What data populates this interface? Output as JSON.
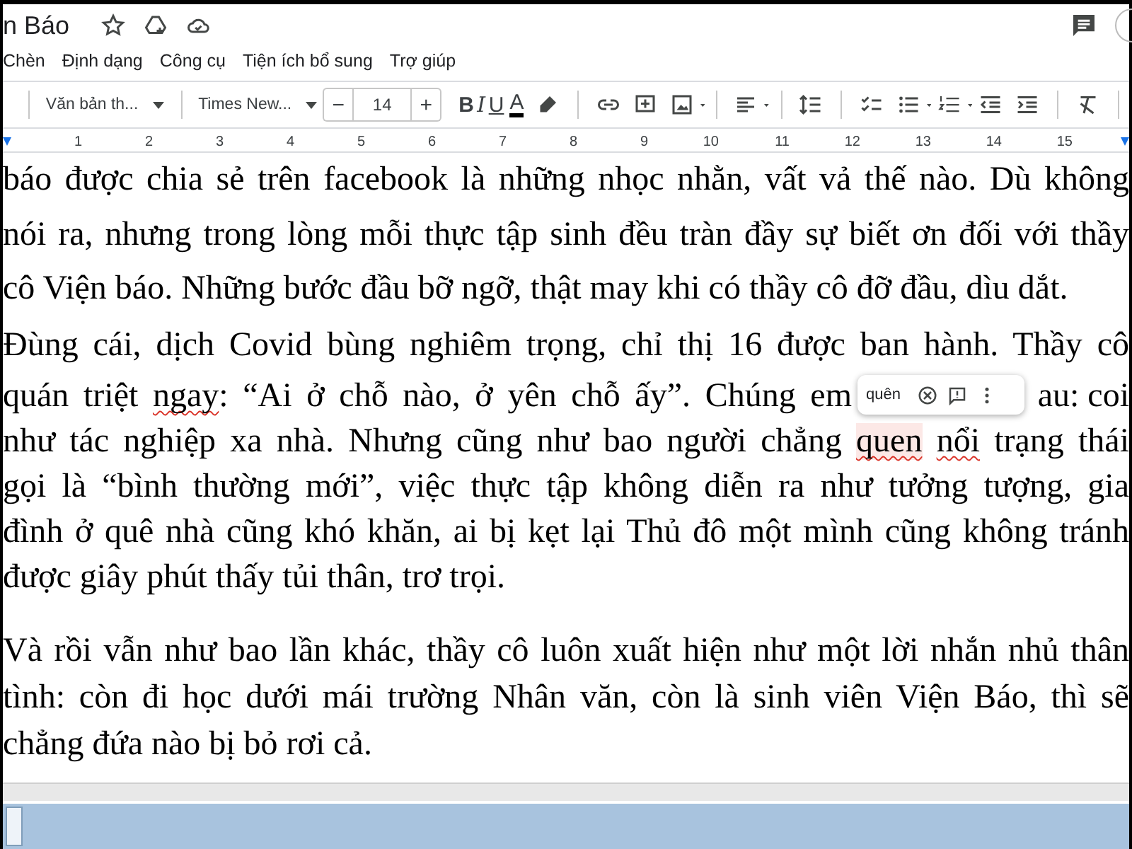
{
  "document": {
    "title": "n Báo"
  },
  "menu": [
    "Chèn",
    "Định dạng",
    "Công cụ",
    "Tiện ích bổ sung",
    "Trợ giúp"
  ],
  "toolbar": {
    "style": "Văn bản th...",
    "font": "Times New...",
    "decrease": "−",
    "size": "14",
    "increase": "+",
    "bold": "B",
    "italic": "I",
    "underline": "U",
    "text_color": "A"
  },
  "ruler": [
    "1",
    "2",
    "3",
    "4",
    "5",
    "6",
    "7",
    "8",
    "9",
    "10",
    "11",
    "12",
    "13",
    "14",
    "15"
  ],
  "paragraphs": [
    {
      "lines": [
        {
          "segments": [
            {
              "text": "báo được chia sẻ trên facebook là những nhọc nhằn, vất vả thế nào. Dù không",
              "flagged": false,
              "active": false
            }
          ]
        },
        {
          "segments": [
            {
              "text": "nói ra, nhưng trong lòng mỗi thực tập sinh đều tràn đầy sự biết ơn đối với thầy",
              "flagged": false,
              "active": false
            }
          ]
        },
        {
          "segments": [
            {
              "text": "cô Viện báo. Những bước đầu bỡ ngỡ, thật may khi có thầy cô đỡ đầu, dìu dắt.",
              "flagged": false,
              "active": false
            }
          ]
        }
      ]
    },
    {
      "lines": [
        {
          "segments": [
            {
              "text": "Đùng cái, dịch Covid bùng nghiêm trọng, chỉ thị 16 được ban hành. Thầy cô",
              "flagged": false,
              "active": false
            }
          ]
        },
        {
          "segments": [
            {
              "text": "quán triệt ",
              "flagged": false,
              "active": false
            },
            {
              "text": "ngay",
              "flagged": true,
              "active": false
            },
            {
              "text": ": “Ai ở chỗ nào, ở yên chỗ ấy”. Chúng em",
              "flagged": false,
              "active": false
            }
          ],
          "right_segments": [
            {
              "text": "au: coi",
              "flagged": false,
              "active": false
            }
          ]
        },
        {
          "segments": [
            {
              "text": "như tác nghiệp xa nhà. Nhưng cũng như bao người chẳng ",
              "flagged": false,
              "active": false
            },
            {
              "text": "quen",
              "flagged": true,
              "active": true
            },
            {
              "text": " nổi",
              "flagged": true,
              "active": false
            },
            {
              "text": " trạng thái",
              "flagged": false,
              "active": false
            }
          ]
        },
        {
          "segments": [
            {
              "text": "gọi là “bình thường mới”, việc thực tập không diễn ra như tưởng tượng, gia",
              "flagged": false,
              "active": false
            }
          ]
        },
        {
          "segments": [
            {
              "text": "đình ở quê nhà cũng khó khăn, ai bị kẹt lại Thủ đô một mình cũng không tránh",
              "flagged": false,
              "active": false
            }
          ]
        },
        {
          "segments": [
            {
              "text": "được giây phút thấy tủi thân, trơ trọi.",
              "flagged": false,
              "active": false
            }
          ]
        }
      ]
    },
    {
      "lines": [
        {
          "segments": [
            {
              "text": "Và rồi vẫn như bao lần khác, thầy cô luôn xuất hiện như một lời nhắn nhủ thân",
              "flagged": false,
              "active": false
            }
          ]
        },
        {
          "segments": [
            {
              "text": "tình: còn đi học dưới mái trường Nhân văn, còn là sinh viên Viện Báo, thì sẽ",
              "flagged": false,
              "active": false
            }
          ]
        },
        {
          "segments": [
            {
              "text": "chẳng đứa nào bị bỏ rơi cả.",
              "flagged": false,
              "active": false
            }
          ]
        }
      ]
    }
  ],
  "spelling_popup": {
    "suggestion": "quên"
  }
}
